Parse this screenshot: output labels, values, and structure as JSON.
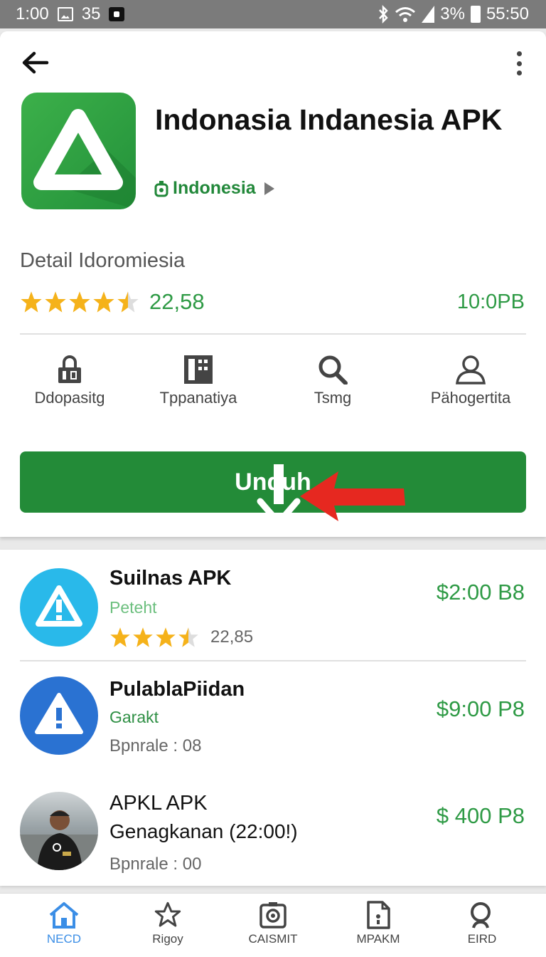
{
  "status_bar": {
    "time": "1:00",
    "notif_count": "35",
    "battery": "3%",
    "clock_right": "55:50"
  },
  "app": {
    "title": "Indonasia Indanesia APK",
    "developer": "Indonesia",
    "detail_label": "Detail Idoromiesia",
    "rating": "22,58",
    "size": "10:0PB",
    "install_label": "Unduh"
  },
  "features": [
    {
      "label": "Ddopasitg",
      "icon": "lock-icon"
    },
    {
      "label": "Tppanatiya",
      "icon": "grid-icon"
    },
    {
      "label": "Tsmg",
      "icon": "search-icon"
    },
    {
      "label": "Pähogertita",
      "icon": "person-icon"
    }
  ],
  "list": [
    {
      "name": "Suilnas APK",
      "sub": "Peteht",
      "meta": "22,85",
      "price": "$2:00 B8"
    },
    {
      "name": "PulablaPiidan",
      "sub": "Garakt",
      "meta": "Bpnrale : 08",
      "price": "$9:00 P8"
    },
    {
      "name": "APKL APK",
      "sub": "Genagkanan  (22:00!)",
      "meta": "Bpnrale : 00",
      "price": "$ 400 P8"
    }
  ],
  "nav": [
    {
      "label": "NECD",
      "icon": "home-icon"
    },
    {
      "label": "Rigoy",
      "icon": "star-icon"
    },
    {
      "label": "CAISMIT",
      "icon": "camera-icon"
    },
    {
      "label": "MPAKM",
      "icon": "document-icon"
    },
    {
      "label": "EIRD",
      "icon": "search-icon"
    }
  ],
  "colors": {
    "accent": "#238b38",
    "price_green": "#2e9a45",
    "star": "#f5b21a",
    "nav_active": "#3b8ee6"
  }
}
